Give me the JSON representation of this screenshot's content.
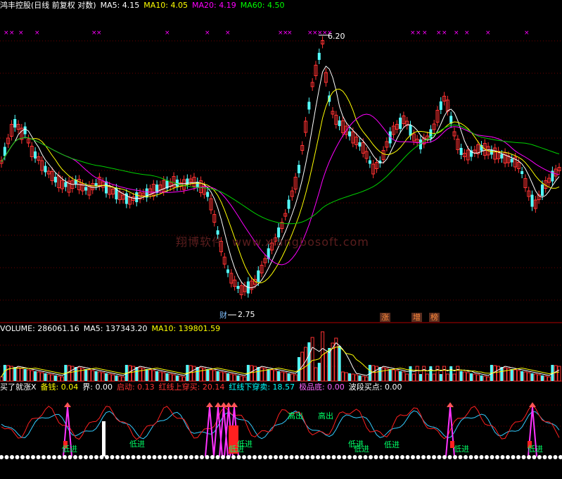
{
  "price": {
    "title": "鸿丰控股(日线 前复权 对数)",
    "ma": [
      {
        "label": "MA5: 4.15",
        "color": "#ffffff"
      },
      {
        "label": "MA10: 4.05",
        "color": "#ffff00"
      },
      {
        "label": "MA20: 4.19",
        "color": "#ff00ff"
      },
      {
        "label": "MA60: 4.50",
        "color": "#00ff00"
      }
    ],
    "high_label": "6.20",
    "low_label": "2.75",
    "low_marker": "财",
    "tags": [
      "涨",
      "增",
      "榜"
    ]
  },
  "watermark": {
    "cn": "翔博软件",
    "url": "www.xiangbosoft.com"
  },
  "volume": {
    "items": [
      {
        "label": "VOLUME: 286061.16",
        "color": "#ffffff"
      },
      {
        "label": "MA5: 137343.20",
        "color": "#ffffff"
      },
      {
        "label": "MA10: 139801.59",
        "color": "#ffff00"
      }
    ]
  },
  "indicator": {
    "items": [
      {
        "label": "买了就涨X",
        "color": "#ffffff"
      },
      {
        "label": "备钱: 0.04",
        "color": "#ffff00"
      },
      {
        "label": "界: 0.00",
        "color": "#ffffff"
      },
      {
        "label": "启动: 0.13",
        "color": "#ff3333"
      },
      {
        "label": "红线上穿买: 20.14",
        "color": "#ff3333"
      },
      {
        "label": "红线下穿卖: 18.57",
        "color": "#00ffff"
      },
      {
        "label": "极品底: 0.00",
        "color": "#ff66ff"
      },
      {
        "label": "波段买点: 0.00",
        "color": "#ffffff"
      }
    ],
    "di_jin": "低进",
    "gao_chu": "高出"
  },
  "chart_data": {
    "type": "line",
    "title": "鸿丰控股(日线 前复权 对数)",
    "panels": [
      "price",
      "volume",
      "indicator"
    ],
    "series": [
      {
        "name": "MA5",
        "values": [
          4.15
        ]
      },
      {
        "name": "MA10",
        "values": [
          4.05
        ]
      },
      {
        "name": "MA20",
        "values": [
          4.19
        ]
      },
      {
        "name": "MA60",
        "values": [
          4.5
        ]
      }
    ],
    "price_high": 6.2,
    "price_low": 2.75,
    "volume": {
      "last": 286061.16,
      "ma5": 137343.2,
      "ma10": 139801.59
    },
    "indicator_values": {
      "备钱": 0.04,
      "界": 0.0,
      "启动": 0.13,
      "红线上穿买": 20.14,
      "红线下穿卖": 18.57,
      "极品底": 0.0,
      "波段买点": 0.0
    }
  }
}
